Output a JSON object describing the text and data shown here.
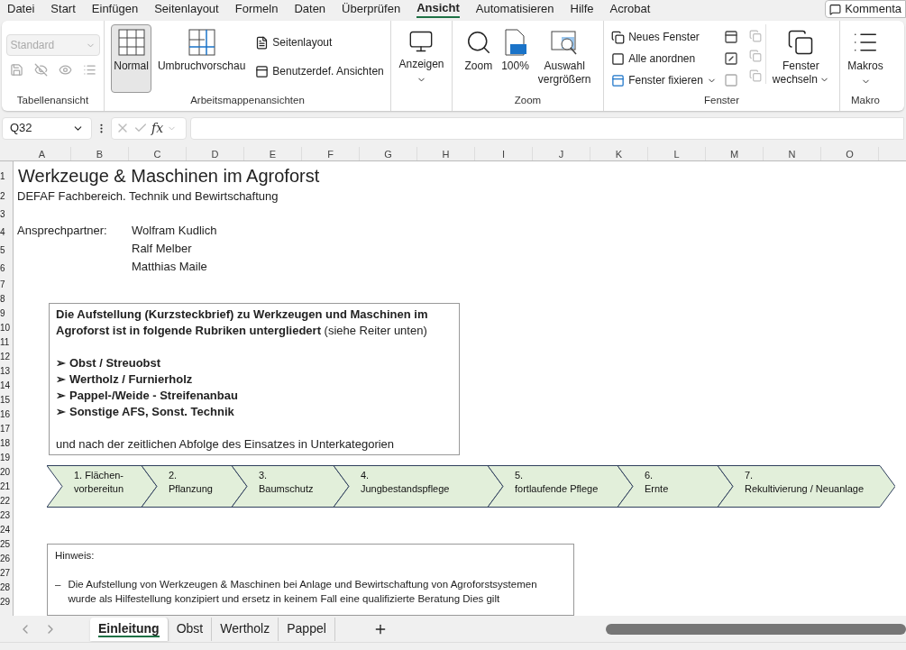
{
  "menu_tabs": [
    {
      "label": "Datei",
      "selected": false
    },
    {
      "label": "Start",
      "selected": false
    },
    {
      "label": "Einfügen",
      "selected": false
    },
    {
      "label": "Seitenlayout",
      "selected": false
    },
    {
      "label": "Formeln",
      "selected": false
    },
    {
      "label": "Daten",
      "selected": false
    },
    {
      "label": "Überprüfen",
      "selected": false
    },
    {
      "label": "Ansicht",
      "selected": true
    },
    {
      "label": "Automatisieren",
      "selected": false
    },
    {
      "label": "Hilfe",
      "selected": false
    },
    {
      "label": "Acrobat",
      "selected": false
    }
  ],
  "comment_button": "Kommenta",
  "ribbon": {
    "sheet_view": {
      "label": "Tabellenansicht",
      "dropdown": "Standard",
      "disabled": true
    },
    "workbook_views": {
      "label": "Arbeitsmappenansichten",
      "big": [
        {
          "label": "Normal",
          "selected": true
        },
        {
          "label": "Umbruchvorschau",
          "selected": false
        }
      ],
      "small": [
        "Seitenlayout",
        "Benutzerdef. Ansichten"
      ]
    },
    "show": {
      "label": "Anzeigen"
    },
    "zoom": {
      "label": "Zoom",
      "buttons": [
        "Zoom",
        "100%",
        "Auswahl vergrößern"
      ]
    },
    "window": {
      "label": "Fenster",
      "small": [
        "Neues Fenster",
        "Alle anordnen",
        "Fenster fixieren"
      ],
      "switch": "Fenster wechseln"
    },
    "macros": {
      "label": "Makro",
      "button": "Makros"
    }
  },
  "name_box": "Q32",
  "function_label": "fx",
  "columns": [
    "A",
    "B",
    "C",
    "D",
    "E",
    "F",
    "G",
    "H",
    "I",
    "J",
    "K",
    "L",
    "M",
    "N",
    "O"
  ],
  "rows": [
    "1",
    "2",
    "3",
    "4",
    "5",
    "6",
    "7",
    "8",
    "9",
    "10",
    "11",
    "12",
    "13",
    "14",
    "15",
    "16",
    "17",
    "18",
    "19",
    "20",
    "21",
    "22",
    "23",
    "24",
    "25",
    "26",
    "27",
    "28",
    "29"
  ],
  "sheet": {
    "title": "Werkzeuge & Maschinen im Agroforst",
    "subtitle": "DEFAF Fachbereich. Technik und Bewirtschaftung",
    "contact_label": "Ansprechpartner:",
    "contacts": [
      "Wolfram Kudlich",
      "Ralf Melber",
      "Matthias Maile"
    ],
    "overview": {
      "intro": "**Die Aufstellung (Kurzsteckbrief) zu Werkzeugen und Maschinen im Agroforst ist in folgende Rubriken untergliedert**  (siehe Reiter unten)",
      "items": [
        {
          "bullet": "➢",
          "text": "Obst / Streuobst"
        },
        {
          "bullet": "➢",
          "text": "Wertholz / Furnierholz"
        },
        {
          "bullet": "➢",
          "text": "Pappel-/Weide  - Streifenanbau"
        },
        {
          "bullet": "➢",
          "text": "Sonstige AFS, Sonst. Technik"
        }
      ],
      "outro": "und nach der zeitlichen Abfolge des Einsatzes in Unterkategorien"
    },
    "steps": [
      {
        "line1": "1. Flächen-",
        "line2": "vorbereitun"
      },
      {
        "line1": "2.",
        "line2": "Pflanzung"
      },
      {
        "line1": "3.",
        "line2": "Baumschutz"
      },
      {
        "line1": "4.",
        "line2": "Jungbestandspflege"
      },
      {
        "line1": "5.",
        "line2": "fortlaufende Pflege"
      },
      {
        "line1": "6.",
        "line2": "Ernte"
      },
      {
        "line1": "7.",
        "line2": "Rekultivierung / Neuanlage"
      }
    ],
    "hint": {
      "heading": "Hinweis:",
      "bullet": "–",
      "lines": [
        "Die Aufstellung von Werkzeugen & Maschinen bei Anlage und Bewirtschaftung von Agroforstsystemen",
        "wurde als Hilfestellung konzipiert und ersetz in keinem Fall eine qualifizierte Beratung Dies gilt"
      ]
    }
  },
  "sheet_tabs": [
    {
      "label": "Einleitung",
      "selected": true
    },
    {
      "label": "Obst",
      "selected": false
    },
    {
      "label": "Wertholz",
      "selected": false
    },
    {
      "label": "Pappel",
      "selected": false
    }
  ]
}
